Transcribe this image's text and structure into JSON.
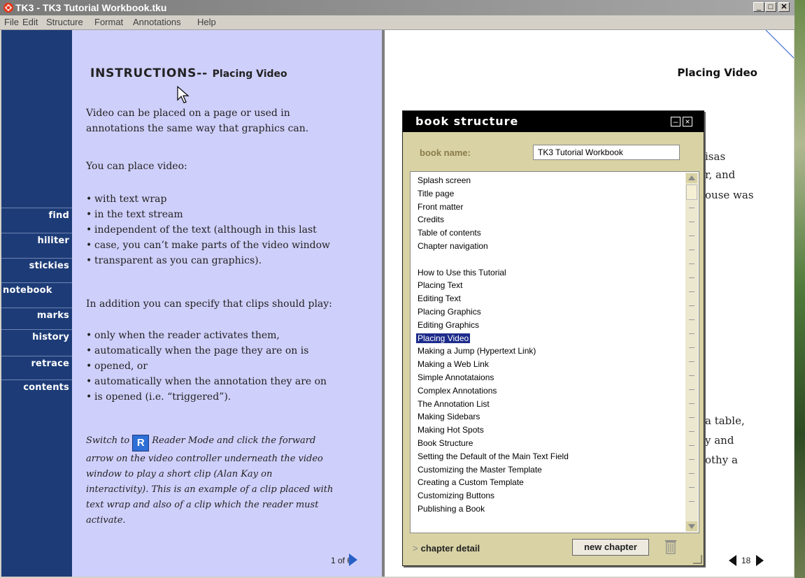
{
  "window": {
    "title": "TK3 - TK3 Tutorial Workbook.tku",
    "controls": {
      "minimize": "_",
      "maximize": "□",
      "close": "✕"
    }
  },
  "menu": [
    "File",
    "Edit",
    "Structure",
    "Format",
    "Annotations",
    "Help"
  ],
  "sidebar": {
    "buttons": [
      "find",
      "hiliter",
      "stickies",
      "notebook",
      "marks",
      "history",
      "retrace",
      "contents"
    ]
  },
  "left_page": {
    "heading": "INSTRUCTIONS--",
    "subheading": "Placing Video",
    "para1_line1": "Video can be placed on a page or used in",
    "para1_line2": "annotations the same way that graphics can.",
    "para2": "You can place video:",
    "bullets1": [
      "with text wrap",
      "in the text stream",
      "independent of the text (although in this last",
      "case, you can’t make parts of the video window",
      "transparent as you can graphics)."
    ],
    "para3": "In addition you can specify that clips should play:",
    "bullets2": [
      "only when the reader activates them,",
      "automatically when the page they are on is",
      "opened, or",
      "automatically when the annotation they are on",
      "is opened (i.e. “triggered”)."
    ],
    "switch_prefix": "Switch to",
    "reader_badge": "R",
    "switch_rest": "Reader Mode and click the forward",
    "italic_lines": [
      "arrow on the video controller underneath the video",
      "window to play a short clip (Alan Kay on",
      "interactivity). This is an example of a clip placed with",
      "text wrap and also of a clip which the reader must",
      "activate."
    ],
    "page_indicator": "1 of 6"
  },
  "right_page": {
    "title": "Placing Video",
    "peek_text": [
      "isas",
      "r, and",
      "ouse was",
      "a table,",
      "y and",
      "othy a"
    ],
    "page_number": "18"
  },
  "palette": {
    "title": "book structure",
    "book_name_label": "book name:",
    "book_name_value": "TK3 Tutorial Workbook",
    "chapters_group1": [
      "Splash screen",
      "Title page",
      "Front matter",
      "Credits",
      "Table of contents",
      "Chapter navigation"
    ],
    "chapters_group2": [
      "How to Use this Tutorial",
      "Placing Text",
      "Editing Text",
      "Placing Graphics",
      "Editing Graphics",
      "Placing Video",
      "Making a Jump (Hypertext Link)",
      "Making a Web Link",
      "Simple Annotataions",
      "Complex Annotations",
      "The Annotation List",
      "Making Sidebars",
      "Making Hot Spots",
      "Book Structure",
      "Setting the Default of the Main Text Field",
      "Customizing the Master Template",
      "Creating a Custom Template",
      "Customizing Buttons",
      "Publishing a Book"
    ],
    "selected_chapter": "Placing Video",
    "chapter_detail": "chapter detail",
    "new_chapter": "new chapter"
  },
  "colors": {
    "sidebar": "#1d3c77",
    "left_page_bg": "#cfcffb",
    "palette_bg": "#d8d2a4",
    "selection": "#1d2b8c",
    "arrow_blue": "#2860c8"
  }
}
